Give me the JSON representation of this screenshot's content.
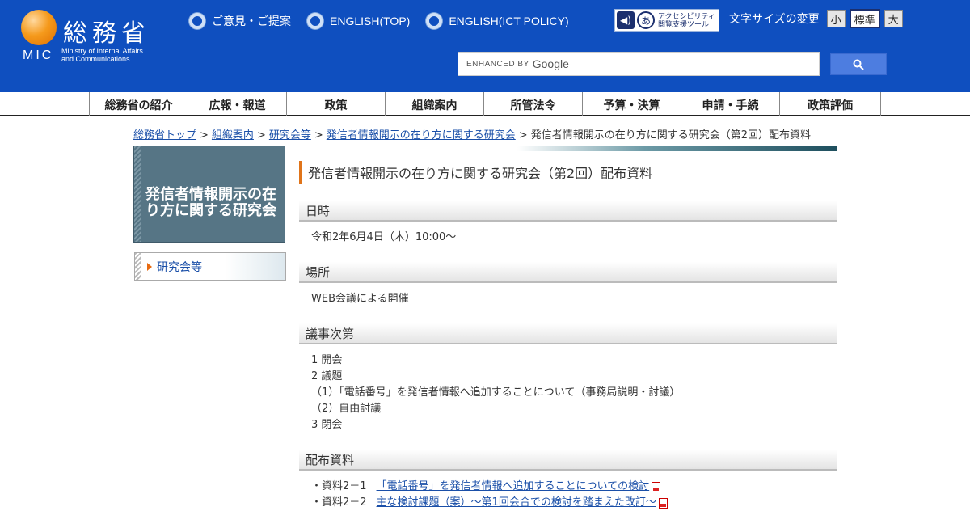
{
  "header": {
    "logo_title": "総務省",
    "logo_mic": "MIC",
    "logo_sub_line1": "Ministry of Internal Affairs",
    "logo_sub_line2": "and Communications",
    "top_links": [
      "ご意見・ご提案",
      "ENGLISH(TOP)",
      "ENGLISH(ICT POLICY)"
    ],
    "access_tool_line1": "アクセシビリティ",
    "access_tool_line2": "閲覧支援ツール",
    "font_size_label": "文字サイズの変更",
    "font_sizes": [
      "小",
      "標準",
      "大"
    ],
    "search_label": "ENHANCED BY",
    "search_brand": "Google"
  },
  "nav": [
    "総務省の紹介",
    "広報・報道",
    "政策",
    "組織案内",
    "所管法令",
    "予算・決算",
    "申請・手続",
    "政策評価"
  ],
  "breadcrumb": {
    "links": [
      "総務省トップ",
      "組織案内",
      "研究会等",
      "発信者情報開示の在り方に関する研究会"
    ],
    "current": "発信者情報開示の在り方に関する研究会（第2回）配布資料"
  },
  "sidebar": {
    "title": "発信者情報開示の在り方に関する研究会",
    "menu_item": "研究会等"
  },
  "main": {
    "title": "発信者情報開示の在り方に関する研究会（第2回）配布資料",
    "sections": {
      "datetime": {
        "heading": "日時",
        "body": "令和2年6月4日（木）10:00～"
      },
      "place": {
        "heading": "場所",
        "body": "WEB会議による開催"
      },
      "agenda": {
        "heading": "議事次第",
        "lines": [
          "1 開会",
          "2 議題",
          "（1）「電話番号」を発信者情報へ追加することについて（事務局説明・討議）",
          "（2）自由討議",
          "3 閉会"
        ]
      },
      "materials": {
        "heading": "配布資料",
        "docs": [
          {
            "label": "・資料2－1",
            "title": "「電話番号」を発信者情報へ追加することについての検討"
          },
          {
            "label": "・資料2－2",
            "title": "主な検討課題（案）～第1回会合での検討を踏まえた改訂～"
          }
        ]
      }
    }
  }
}
